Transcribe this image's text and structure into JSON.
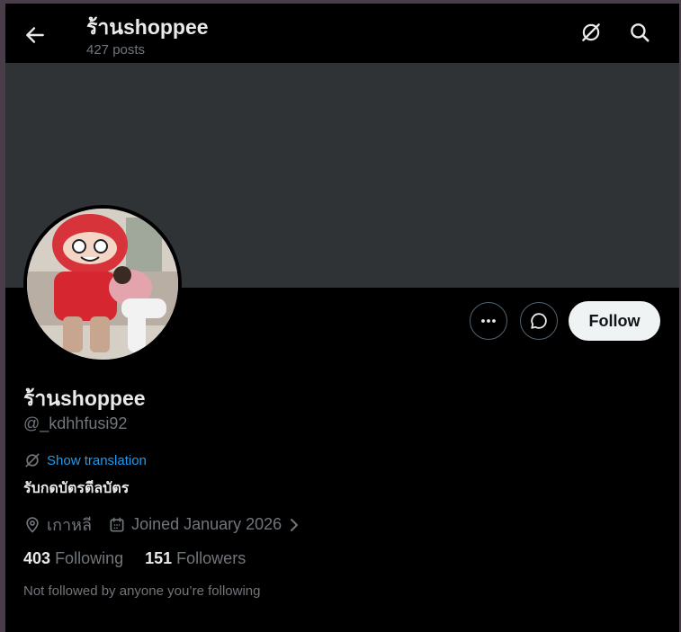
{
  "header": {
    "title": "ร้านshoppee",
    "posts_count": "427 posts"
  },
  "profile": {
    "display_name": "ร้านshoppee",
    "handle": "@_kdhhfusi92",
    "translate_label": "Show translation",
    "bio": "รับกดบัตรตีลบัตร",
    "location": "เกาหลี",
    "joined": "Joined January 2026",
    "following_count": "403",
    "following_label": "Following",
    "followers_count": "151",
    "followers_label": "Followers",
    "not_followed_text": "Not followed by anyone you’re following"
  },
  "actions": {
    "follow_label": "Follow"
  },
  "icons": {
    "back": "arrow-left-icon",
    "translate_header": "grok-icon",
    "search": "search-icon",
    "more": "more-horizontal-icon",
    "message": "chat-bubble-icon",
    "location": "location-pin-icon",
    "calendar": "calendar-icon",
    "chevron": "chevron-right-icon"
  },
  "colors": {
    "background": "#000000",
    "banner": "#2f3336",
    "link": "#1d9bf0",
    "muted": "#71767b",
    "follow_button": "#eff3f4"
  }
}
